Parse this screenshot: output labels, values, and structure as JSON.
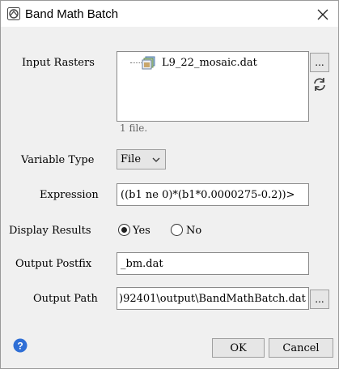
{
  "window": {
    "title": "Band Math Batch"
  },
  "labels": {
    "input_rasters": "Input Rasters",
    "variable_type": "Variable Type",
    "expression": "Expression",
    "display_results": "Display Results",
    "output_postfix": "Output Postfix",
    "output_path": "Output Path"
  },
  "input_rasters": {
    "files": [
      "L9_22_mosaic.dat"
    ],
    "count_text": "1 file."
  },
  "variable_type": {
    "selected": "File"
  },
  "expression": {
    "value": "((b1 ne 0)*(b1*0.0000275-0.2))>"
  },
  "display_results": {
    "yes": "Yes",
    "no": "No",
    "selected": "Yes"
  },
  "output_postfix": {
    "value": "_bm.dat"
  },
  "output_path": {
    "value": ")92401\\output\\BandMathBatch.dat"
  },
  "buttons": {
    "browse": "...",
    "ok": "OK",
    "cancel": "Cancel"
  },
  "colors": {
    "help_icon": "#2f6fd6"
  }
}
